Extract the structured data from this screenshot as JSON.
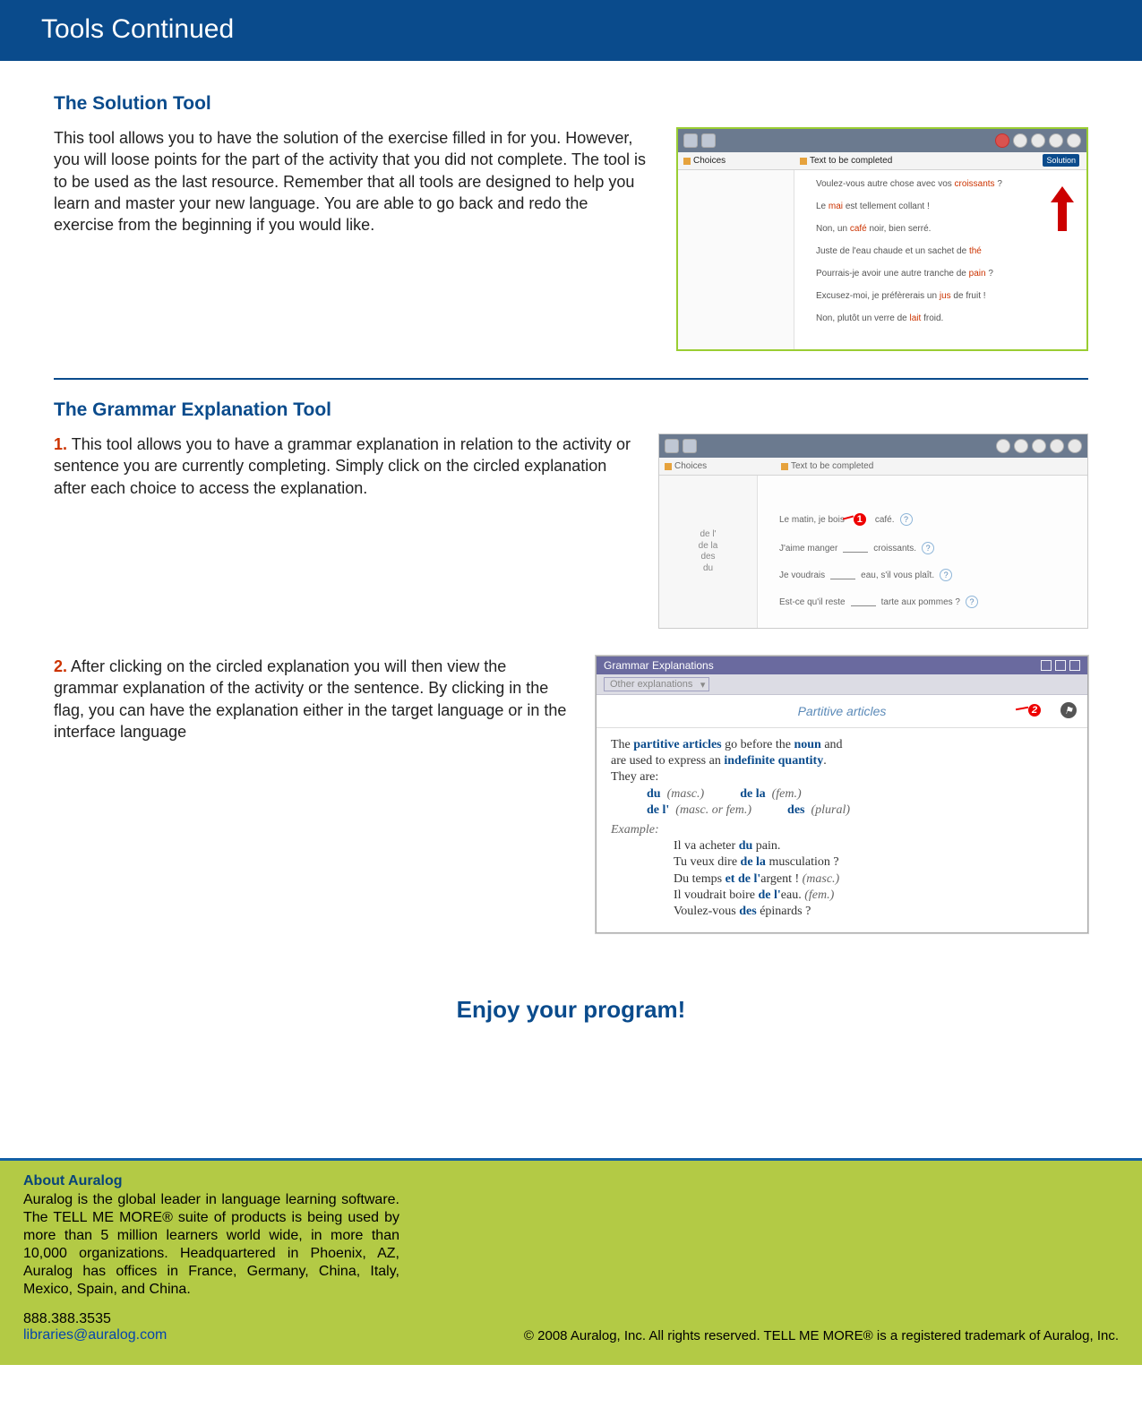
{
  "header": {
    "title": "Tools Continued"
  },
  "section1": {
    "heading": "The Solution Tool",
    "body": "This tool allows you to have the solution of the exercise filled in for you. However, you will loose points for the part of the activity that you did not complete. The tool is to be used as the last resource. Remember that all tools are designed to help you learn and master your new language.  You are able to go back and redo the exercise from the beginning if you would like.",
    "shot": {
      "choices_label": "Choices",
      "text_label": "Text to be completed",
      "tooltip": "Solution",
      "lines": [
        {
          "pre": "Voulez-vous autre chose avec vos",
          "ans": "croissants",
          "post": "?"
        },
        {
          "pre": "Le",
          "ans": "mai",
          "post": "est tellement collant !"
        },
        {
          "pre": "Non, un",
          "ans": "café",
          "post": "noir, bien serré."
        },
        {
          "pre": "Juste de l'eau chaude et un sachet de",
          "ans": "thé"
        },
        {
          "pre": "Pourrais-je avoir une autre tranche de",
          "ans": "pain",
          "post": "?"
        },
        {
          "pre": "Excusez-moi, je préfèrerais un",
          "ans": "jus",
          "post": "de fruit !"
        },
        {
          "pre": "Non, plutôt un verre de",
          "ans": "lait",
          "post": "froid."
        }
      ]
    }
  },
  "section2": {
    "heading": "The Grammar Explanation Tool",
    "step1": {
      "num": "1.",
      "body": "This tool allows you to have a grammar explanation in relation to the activity or sentence you are currently completing. Simply click on the circled explanation after each choice to access the explanation."
    },
    "shot2": {
      "choices_label": "Choices",
      "text_label": "Text to be completed",
      "choice_list": [
        "de l'",
        "de la",
        "des",
        "du"
      ],
      "call": "1",
      "lines": [
        {
          "pre": "Le matin, je bois",
          "post": "café."
        },
        {
          "pre": "J'aime manger",
          "post": "croissants."
        },
        {
          "pre": "Je voudrais",
          "post": "eau, s'il vous plaît."
        },
        {
          "pre": "Est-ce qu'il reste",
          "post": "tarte aux pommes ?"
        }
      ]
    },
    "step2": {
      "num": "2.",
      "body": "After clicking on the circled explanation you will then view the grammar explanation of the activity or the sentence. By clicking in the flag, you can have the explanation either in the target language or in the interface language"
    },
    "shot3": {
      "title": "Grammar Explanations",
      "dropdown": "Other explanations",
      "subject": "Partitive articles",
      "call": "2",
      "intro1a": "The ",
      "intro1b": "partitive articles",
      "intro1c": " go before the ",
      "intro1d": "noun",
      "intro1e": " and",
      "intro2a": "are used to express an ",
      "intro2b": "indefinite quantity",
      "intro2c": ".",
      "theyare": "They are:",
      "art": {
        "r1c1a": "du",
        "r1c1b": "(masc.)",
        "r1c2a": "de la",
        "r1c2b": "(fem.)",
        "r2c1a": "de l'",
        "r2c1b": "(masc. or fem.)",
        "r2c2a": "des",
        "r2c2b": "(plural)"
      },
      "example_label": "Example:",
      "ex": {
        "l1a": "Il va acheter ",
        "l1b": "du",
        "l1c": " pain.",
        "l2a": "Tu veux dire ",
        "l2b": "de la",
        "l2c": " musculation ?",
        "l3a": "Du temps ",
        "l3mid": "et",
        "l3b": " de l'",
        "l3c": "argent ! ",
        "l3d": "(masc.)",
        "l4a": "Il voudrait boire ",
        "l4b": "de l'",
        "l4c": "eau. ",
        "l4d": "(fem.)",
        "l5a": "Voulez-vous ",
        "l5b": "des",
        "l5c": " épinards ?"
      }
    }
  },
  "closing": "Enjoy your program!",
  "footer": {
    "about_title": "About Auralog",
    "about_body": "Auralog is the global leader in language learning software. The TELL ME MORE® suite of products is being used by more than 5 million learners world wide, in more than 10,000 organizations. Headquartered in Phoenix, AZ, Auralog has offices in France, Germany, China, Italy, Mexico, Spain, and China.",
    "phone": "888.388.3535",
    "email": "libraries@auralog.com",
    "copyright": "© 2008 Auralog, Inc.  All rights reserved. TELL ME MORE® is a registered trademark of Auralog, Inc."
  }
}
